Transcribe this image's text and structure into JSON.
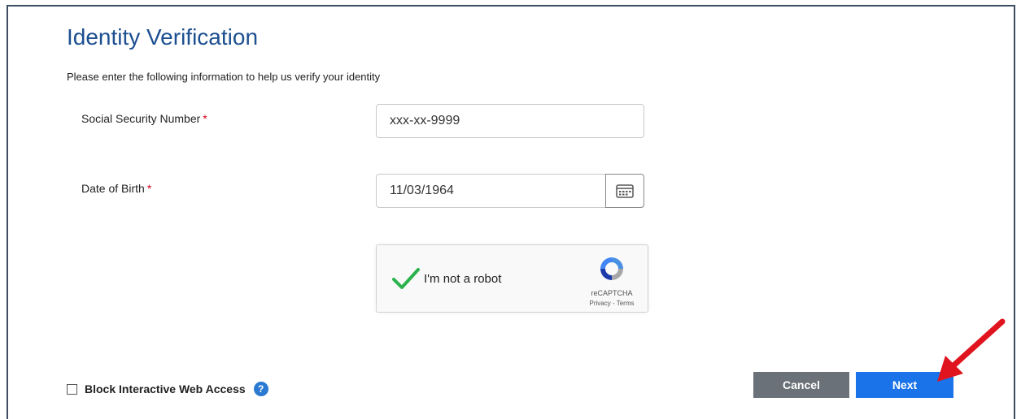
{
  "page": {
    "title": "Identity Verification",
    "instructions": "Please enter the following information to help us verify your identity"
  },
  "fields": {
    "ssn": {
      "label": "Social Security Number",
      "required_mark": "*",
      "value": "xxx-xx-9999"
    },
    "dob": {
      "label": "Date of Birth",
      "required_mark": "*",
      "value": "11/03/1964"
    }
  },
  "captcha": {
    "label": "I'm not a robot",
    "checked": true,
    "brand": "reCAPTCHA",
    "links": "Privacy - Terms"
  },
  "options": {
    "block_access_label": "Block Interactive Web Access",
    "block_access_checked": false,
    "help_glyph": "?"
  },
  "buttons": {
    "cancel_label": "Cancel",
    "next_label": "Next"
  },
  "icons": {
    "calendar": "calendar-icon",
    "help": "help-icon",
    "arrow": "red-arrow-annotation"
  },
  "colors": {
    "title": "#1d4f91",
    "next_button": "#1a73e8",
    "cancel_button": "#6b7178",
    "required": "#d0021b",
    "check": "#2bb24c",
    "annotation_arrow": "#e0141e"
  }
}
